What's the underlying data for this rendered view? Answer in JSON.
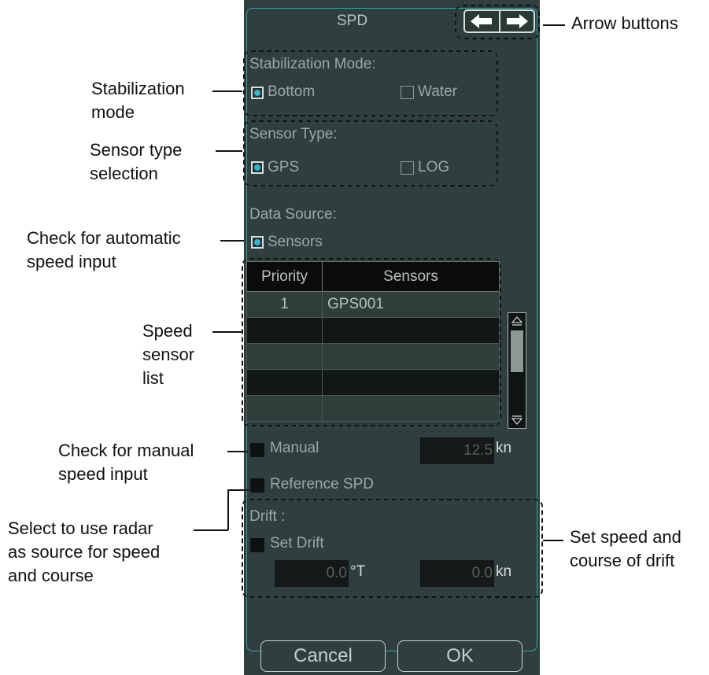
{
  "dialog": {
    "title": "SPD",
    "stabilization": {
      "heading": "Stabilization Mode:",
      "options": [
        "Bottom",
        "Water"
      ],
      "selected": "Bottom"
    },
    "sensor_type": {
      "heading": "Sensor Type:",
      "options": [
        "GPS",
        "LOG"
      ],
      "selected": "GPS"
    },
    "data_source": {
      "heading": "Data Source:",
      "option": "Sensors",
      "checked": true
    },
    "sensor_table": {
      "columns": [
        "Priority",
        "Sensors"
      ],
      "rows": [
        {
          "priority": "1",
          "sensor": "GPS001"
        },
        {
          "priority": "",
          "sensor": ""
        },
        {
          "priority": "",
          "sensor": ""
        },
        {
          "priority": "",
          "sensor": ""
        },
        {
          "priority": "",
          "sensor": ""
        }
      ]
    },
    "manual": {
      "label": "Manual",
      "value": "12.5",
      "unit": "kn"
    },
    "reference_spd": {
      "label": "Reference SPD"
    },
    "drift": {
      "heading": "Drift :",
      "set_drift_label": "Set Drift",
      "course_value": "0.0",
      "course_unit": "°T",
      "speed_value": "0.0",
      "speed_unit": "kn"
    },
    "buttons": {
      "cancel": "Cancel",
      "ok": "OK"
    }
  },
  "callouts": {
    "arrow_buttons": "Arrow buttons",
    "stabilization_mode": [
      "Stabilization",
      "mode"
    ],
    "sensor_type": [
      "Sensor type",
      "selection"
    ],
    "automatic": [
      "Check for automatic",
      "speed input"
    ],
    "speed_list": [
      "Speed",
      "sensor",
      "list"
    ],
    "manual": [
      "Check for manual",
      "speed input"
    ],
    "radar": [
      "Select to use radar",
      "as source for speed",
      "and course"
    ],
    "drift": [
      "Set speed and",
      "course of drift"
    ]
  },
  "colors": {
    "panel_bg": "#2f3f3d",
    "accent": "#2fb9cc",
    "text": "#9aa8a6"
  }
}
